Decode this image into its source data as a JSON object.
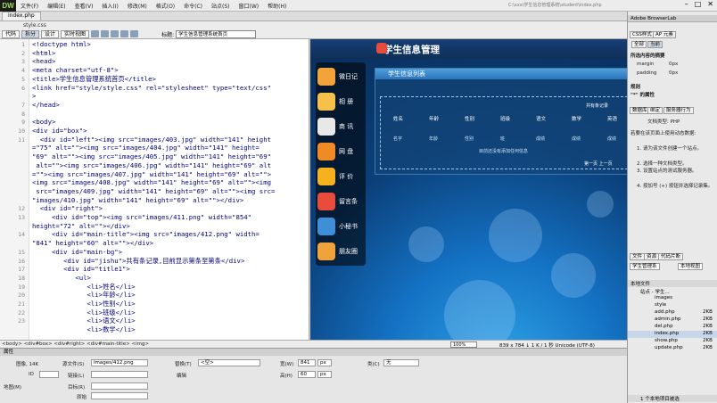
{
  "app": {
    "logo": "DW",
    "path": "C:\\xxx\\学生信息管理系统\\student\\index.php"
  },
  "menu": [
    "文件(F)",
    "编辑(E)",
    "查看(V)",
    "插入(I)",
    "修改(M)",
    "格式(O)",
    "命令(C)",
    "站点(S)",
    "窗口(W)",
    "帮助(H)"
  ],
  "tabs": {
    "active": "index.php",
    "related": "style.css"
  },
  "toolbar": {
    "code": "代码",
    "split": "拆分",
    "design": "设计",
    "live": "实时视图",
    "title_label": "标题:",
    "title_value": "学生信息管理系统首页"
  },
  "code": {
    "line_numbers": [
      "1",
      "2",
      "3",
      "4",
      "5",
      "6",
      "",
      "7",
      "8",
      "9",
      "10",
      "11",
      "",
      "",
      "",
      "",
      "",
      "",
      "",
      "12",
      "13",
      "",
      "14",
      "",
      "15",
      "16",
      "17",
      "18",
      "19",
      "20",
      "21",
      "22",
      "23"
    ],
    "lines": [
      "<!doctype html>",
      "<html>",
      "<head>",
      "<meta charset=\"utf-8\">",
      "<title>学生信息管理系统首页</title>",
      "<link href=\"style/style.css\" rel=\"stylesheet\" type=\"text/css\"",
      ">",
      "</head>",
      "",
      "<body>",
      "<div id=\"box\">",
      "  <div id=\"left\"><img src=\"images/403.jpg\" width=\"141\" height",
      "=\"75\" alt=\"\"><img src=\"images/404.jpg\" width=\"141\" height=",
      "\"69\" alt=\"\"><img src=\"images/405.jpg\" width=\"141\" height=\"69\"",
      " alt=\"\"><img src=\"images/406.jpg\" width=\"141\" height=\"69\" alt",
      "=\"\"><img src=\"images/407.jpg\" width=\"141\" height=\"69\" alt=\"\">",
      "<img src=\"images/408.jpg\" width=\"141\" height=\"69\" alt=\"\"><img",
      " src=\"images/409.jpg\" width=\"141\" height=\"69\" alt=\"\"><img src=",
      "\"images/410.jpg\" width=\"141\" height=\"69\" alt=\"\"></div>",
      "  <div id=\"right\">",
      "     <div id=\"top\"><img src=\"images/411.png\" width=\"854\"",
      "height=\"72\" alt=\"\"></div>",
      "     <div id=\"main-title\"><img src=\"images/412.png\" width=",
      "\"841\" height=\"60\" alt=\"\"></div>",
      "     <div id=\"main-bg\">",
      "        <div id=\"jishu\">共有条记录,目前显示第条至第条</div>",
      "        <div id=\"title1\">",
      "           <ul>",
      "              <li>姓名</li>",
      "              <li>年龄</li>",
      "              <li>性别</li>",
      "              <li>班级</li>",
      "              <li>语文</li>",
      "              <li>数学</li>"
    ]
  },
  "design": {
    "header_title": "学生信息管理",
    "sidebar": [
      "微日记",
      "相 册",
      "商 讯",
      "网 盘",
      "评 价",
      "留言条",
      "小秘书",
      "朋友圈"
    ],
    "panel_title": "学生信息列表",
    "record_info": "共有条记录",
    "columns": [
      "姓名",
      "年龄",
      "性别",
      "班级",
      "语文",
      "数学",
      "英语"
    ],
    "row": [
      "名字",
      "年龄",
      "性别",
      "班",
      "成绩",
      "成绩",
      "成绩"
    ],
    "empty_msg": "目前还没有添加任何信息",
    "pager": "第一页 上一页"
  },
  "status": {
    "tags": "<body> <div#box> <div#right> <div#main-title> <img>",
    "zoom": "100%",
    "dims": "839 x 784 ↓ 1 K / 1 秒 Unicode (UTF-8)"
  },
  "props": {
    "header": "属性",
    "image_label": "图像, 14K",
    "src_label": "源文件(S)",
    "src_value": "images/412.png",
    "alt_label": "替换(T)",
    "alt_value": "<空>",
    "id_label": "ID",
    "link_label": "链接(L)",
    "edit_label": "编辑",
    "map_label": "地图(M)",
    "target_label": "目标(R)",
    "orig_label": "原始",
    "w_label": "宽(W)",
    "w_value": "841",
    "h_label": "高(H)",
    "h_value": "60",
    "unit": "px",
    "class_label": "类(C)",
    "class_value": "无"
  },
  "right": {
    "browserlab": "Adobe BrowserLab",
    "css_tabs": [
      "CSS样式",
      "AP 元素"
    ],
    "sub_tabs": [
      "全部",
      "当前"
    ],
    "summary_title": "所选内容的摘要",
    "summary": [
      [
        "margin",
        "0px"
      ],
      [
        "padding",
        "0px"
      ]
    ],
    "rules_title": "规则",
    "rules_row": "\"*\" 的属性",
    "db_tabs": [
      "数据库",
      "绑定",
      "服务器行为"
    ],
    "doc_type": "文档类型: PHP",
    "steps_intro": "若要在该页面上使用动态数据:",
    "steps": [
      "1. 请为该文件创建一个站点。",
      "2. 选择一种文档类型。",
      "3. 设置站点的测试服务器。",
      "4. 按加号 (+) 按钮并选择记录集。"
    ],
    "files_tabs": [
      "文件",
      "资源",
      "代码片断"
    ],
    "site_select": "学生管理系",
    "view_select": "本地视图",
    "files_hdr": "本地文件",
    "files": [
      {
        "name": "站点 - 学生...",
        "size": ""
      },
      {
        "name": "images",
        "size": ""
      },
      {
        "name": "style",
        "size": ""
      },
      {
        "name": "add.php",
        "size": "2KB"
      },
      {
        "name": "admin.php",
        "size": "2KB"
      },
      {
        "name": "del.php",
        "size": "2KB"
      },
      {
        "name": "index.php",
        "size": "2KB"
      },
      {
        "name": "show.php",
        "size": "2KB"
      },
      {
        "name": "update.php",
        "size": "2KB"
      }
    ],
    "footer": "1 个本地项目被选"
  }
}
